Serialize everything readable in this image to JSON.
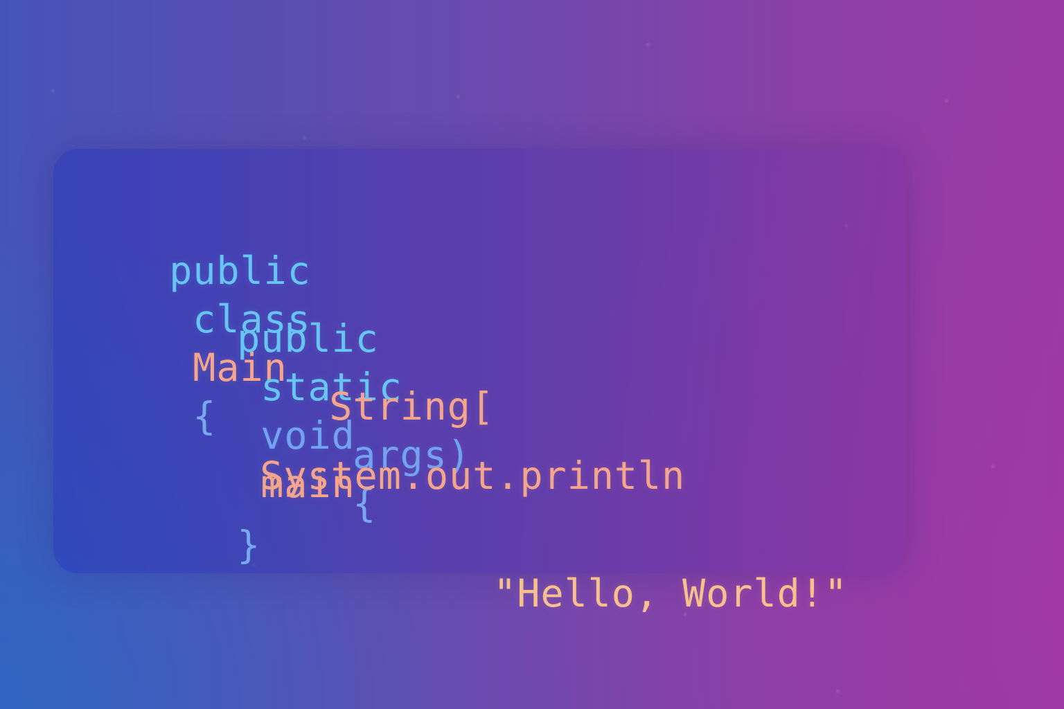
{
  "code": {
    "line1": {
      "public": "public",
      "class": "class",
      "main": "Main",
      "brace": "{"
    },
    "line2": {
      "public": "public",
      "static": "static",
      "void": "void",
      "main": "main"
    },
    "line3": {
      "string": "String[",
      "args": "args)",
      "brace": "{"
    },
    "line4": {
      "system": "System.out.println"
    },
    "line5": {
      "brace": "}",
      "hello": "\"Hello, World!\""
    }
  },
  "colors": {
    "keyword": "#67c5f4",
    "keyword_alt": "#73a3f0",
    "type": "#f4a58d",
    "string": "#f8c08f"
  }
}
